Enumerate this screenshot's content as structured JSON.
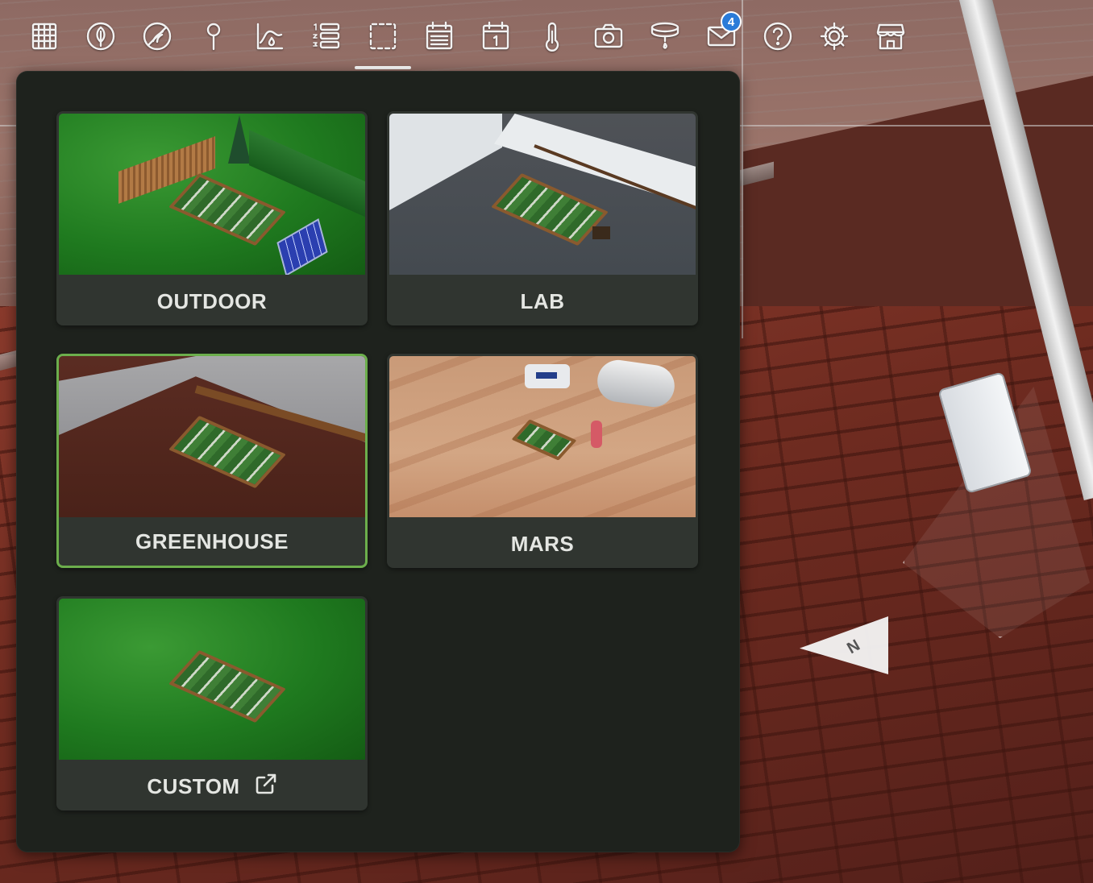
{
  "toolbar": {
    "items": [
      {
        "name": "grid-icon",
        "active": false
      },
      {
        "name": "leaf-icon",
        "active": false
      },
      {
        "name": "no-weeds-icon",
        "active": false
      },
      {
        "name": "map-pin-icon",
        "active": false
      },
      {
        "name": "moisture-chart-icon",
        "active": false
      },
      {
        "name": "sequence-list-icon",
        "active": false
      },
      {
        "name": "dashed-square-icon",
        "active": true
      },
      {
        "name": "event-list-icon",
        "active": false
      },
      {
        "name": "calendar-day-icon",
        "active": false
      },
      {
        "name": "thermometer-icon",
        "active": false
      },
      {
        "name": "camera-icon",
        "active": false
      },
      {
        "name": "watering-nozzle-icon",
        "active": false
      },
      {
        "name": "mail-icon",
        "active": false,
        "badge": "4"
      },
      {
        "name": "help-icon",
        "active": false
      },
      {
        "name": "gear-icon",
        "active": false
      },
      {
        "name": "store-icon",
        "active": false
      }
    ],
    "accent": "#ffffff",
    "badge_color": "#2a7bd8"
  },
  "scenes": {
    "selected": "GREENHOUSE",
    "accent": "#6cae4c",
    "cards": [
      {
        "label": "OUTDOOR"
      },
      {
        "label": "LAB"
      },
      {
        "label": "GREENHOUSE"
      },
      {
        "label": "MARS"
      },
      {
        "label": "CUSTOM",
        "icon": "external-link-icon"
      }
    ]
  },
  "compass": {
    "label": "N"
  }
}
